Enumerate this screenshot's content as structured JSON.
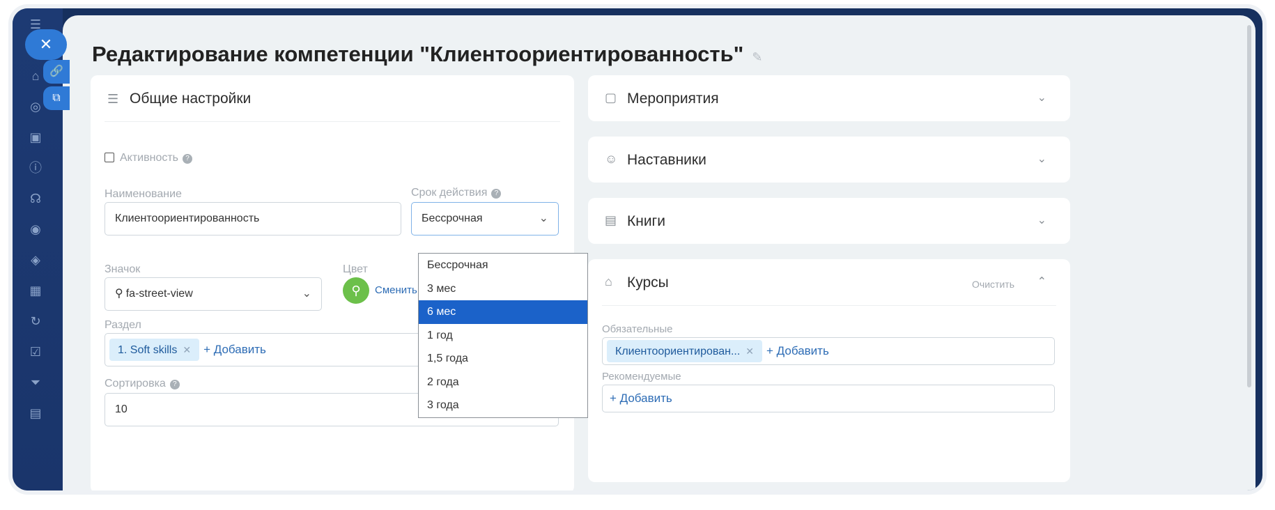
{
  "page": {
    "title": "Редактирование компетенции \"Клиентоориентированность\""
  },
  "general": {
    "header": "Общие настройки",
    "active_label": "Активность",
    "name_label": "Наименование",
    "name_value": "Клиентоориентированность",
    "term_label": "Срок действия",
    "term_value": "Бессрочная",
    "icon_label": "Значок",
    "icon_value": "fa-street-view",
    "color_label": "Цвет",
    "color_change": "Сменить",
    "section_label": "Раздел",
    "section_tags": [
      "1. Soft skills"
    ],
    "add_label": "+ Добавить",
    "sort_label": "Сортировка",
    "sort_value": "10"
  },
  "term_options": {
    "items": [
      "Бессрочная",
      "3 мес",
      "6 мес",
      "1 год",
      "1,5 года",
      "2 года",
      "3 года"
    ],
    "selected": "6 мес"
  },
  "right": {
    "events": "Мероприятия",
    "mentors": "Наставники",
    "books": "Книги",
    "courses": "Курсы",
    "clear": "Очистить",
    "required_label": "Обязательные",
    "required_tag": "Клиентоориентирован...",
    "recommended_label": "Рекомендуемые",
    "add_label": "+ Добавить"
  },
  "colors": {
    "accent": "#2f7ad6",
    "selected": "#1b62c9",
    "icon_green": "#6cc04a",
    "sidebar": "#1a356b"
  }
}
